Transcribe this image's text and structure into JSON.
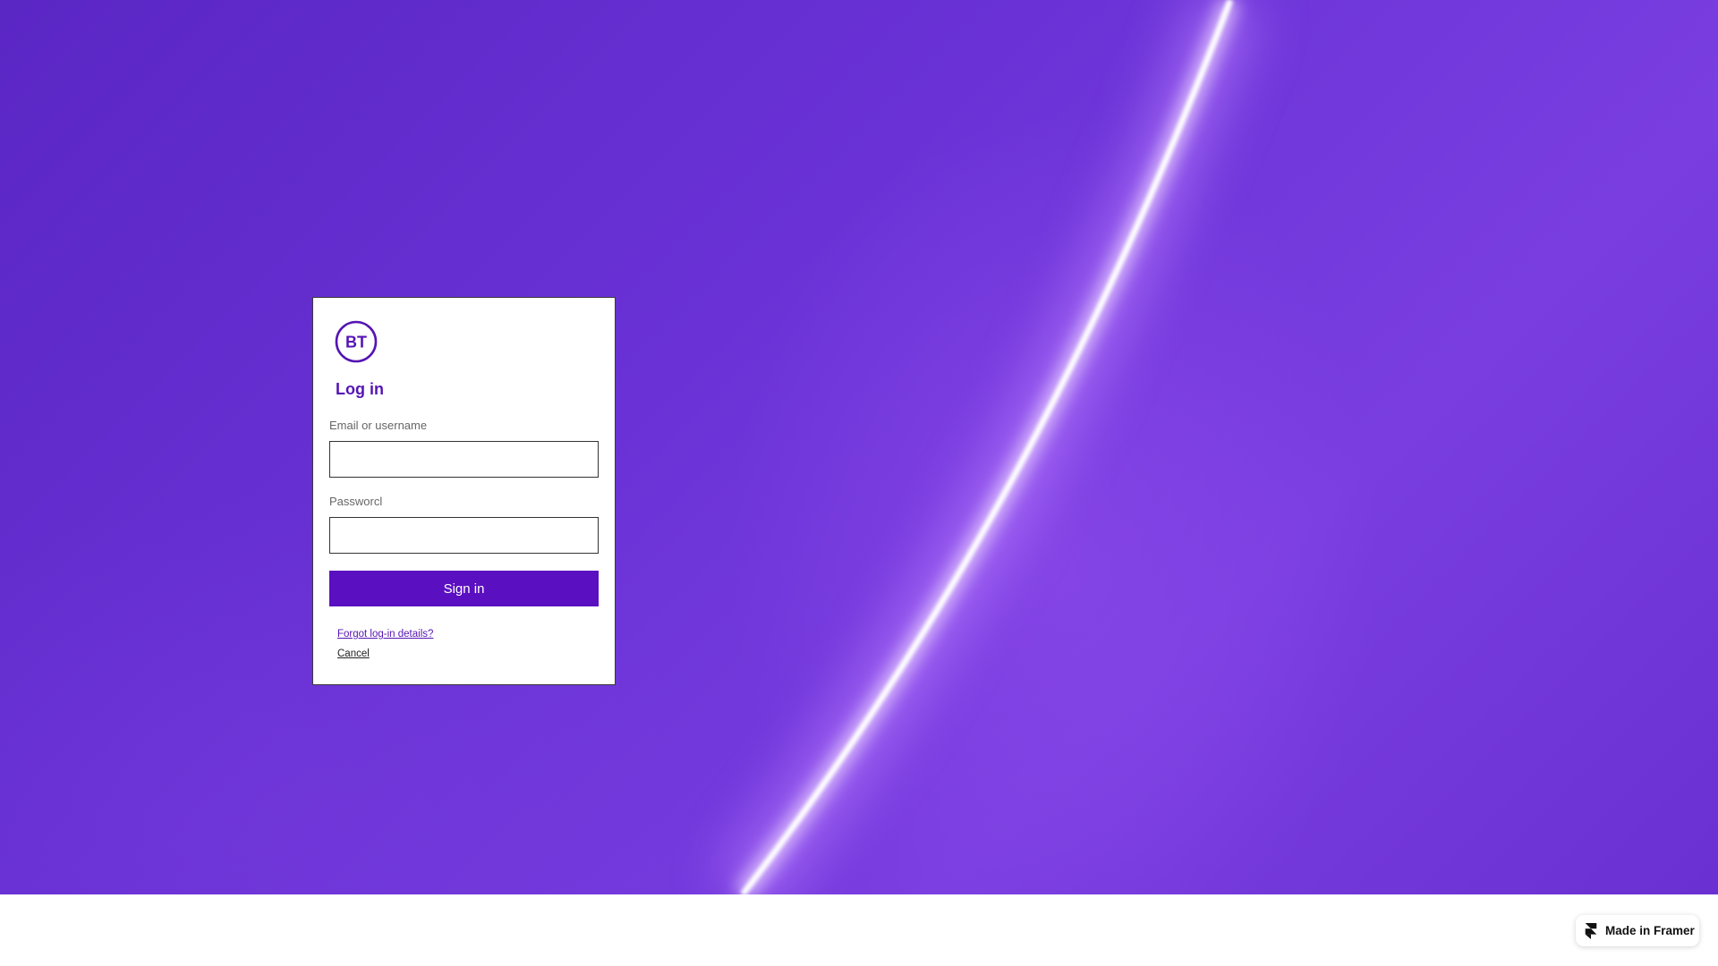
{
  "brand": {
    "logo_text": "BT",
    "accent_color": "#5514b4",
    "button_color": "#5a0fc0"
  },
  "login": {
    "title": "Log in",
    "email_label": "Email or username",
    "email_value": "",
    "password_label": "Passworcl",
    "password_value": "",
    "signin_label": "Sign in",
    "forgot_label": "Forgot log-in details?",
    "cancel_label": "Cancel"
  },
  "badge": {
    "label": "Made in Framer",
    "icon": "framer-icon"
  }
}
